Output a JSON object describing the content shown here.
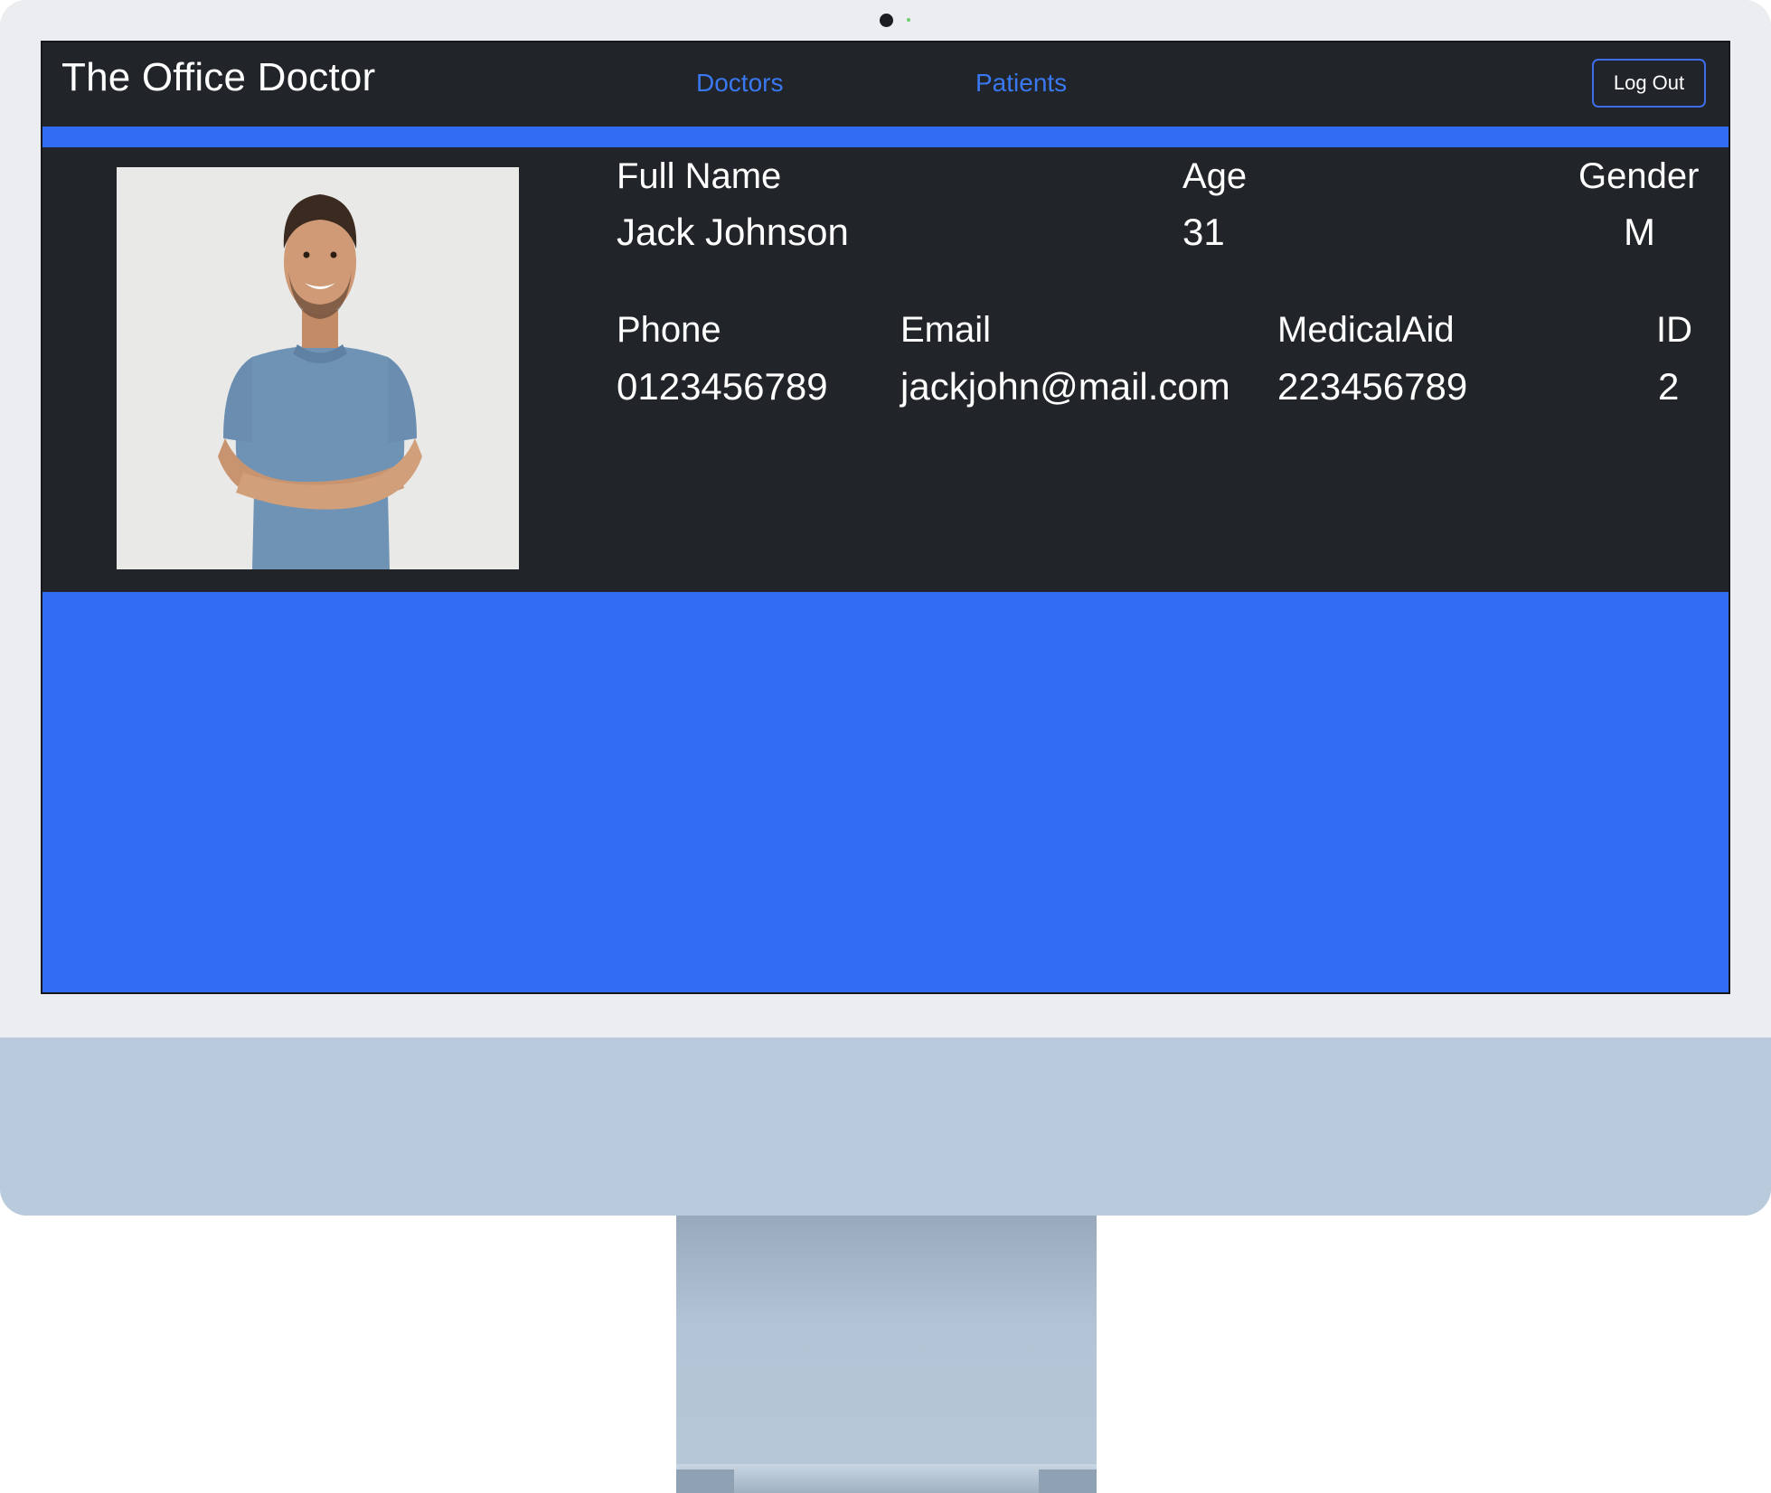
{
  "app": {
    "brand": "The Office Doctor"
  },
  "nav": {
    "doctors_label": "Doctors",
    "patients_label": "Patients",
    "logout_label": "Log Out"
  },
  "patient": {
    "full_name_label": "Full Name",
    "full_name": "Jack Johnson",
    "age_label": "Age",
    "age": "31",
    "gender_label": "Gender",
    "gender": "M",
    "phone_label": "Phone",
    "phone": "0123456789",
    "email_label": "Email",
    "email": "jackjohn@mail.com",
    "medical_aid_label": "MedicalAid",
    "medical_aid": "223456789",
    "id_label": "ID",
    "id": "2",
    "photo_icon": "patient-portrait"
  },
  "colors": {
    "navbar_bg": "#212529",
    "accent_blue": "#326cf3",
    "link_blue": "#3a78f2",
    "monitor_chin": "#b8cadb",
    "monitor_bezel": "#ebedf0"
  }
}
